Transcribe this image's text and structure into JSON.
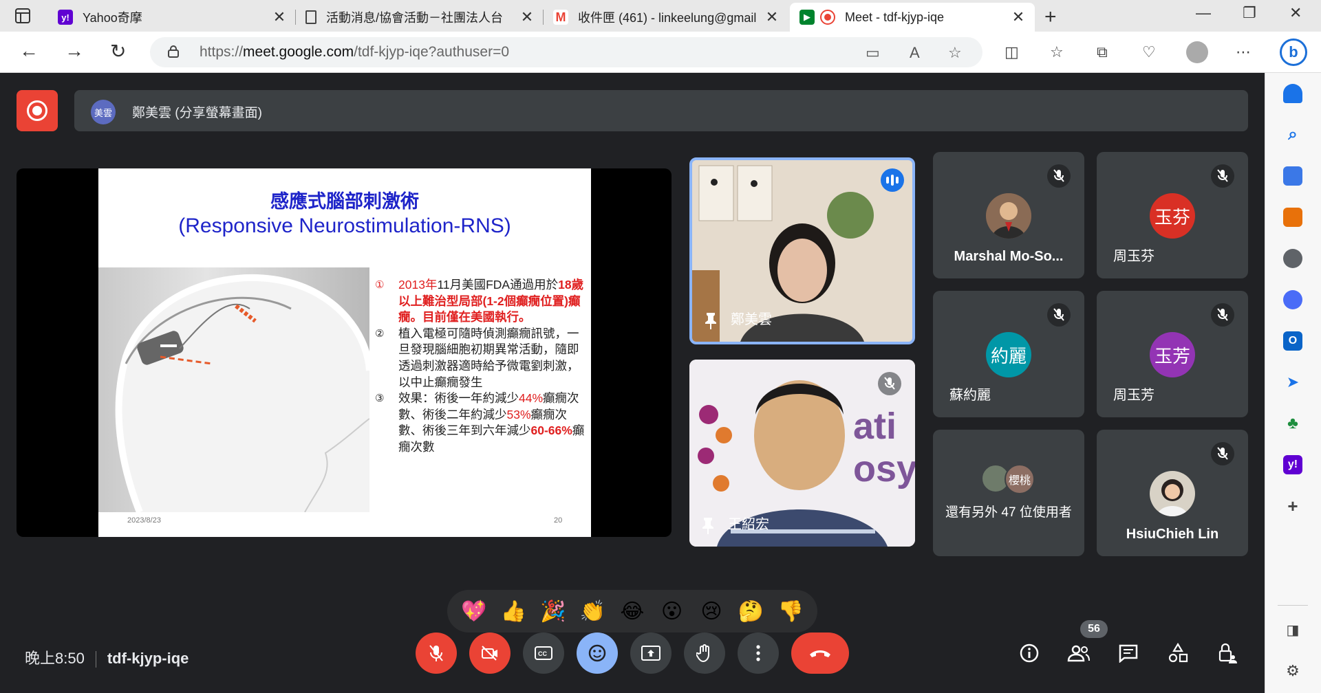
{
  "browser": {
    "tabs": [
      {
        "title": "Yahoo奇摩",
        "favicon": "yahoo-icon",
        "active": false
      },
      {
        "title": "活動消息/協會活動－社團法人台",
        "favicon": "document-icon",
        "active": false
      },
      {
        "title": "收件匣 (461) - linkeelung@gmail",
        "favicon": "gmail-icon",
        "active": false
      },
      {
        "title": "Meet - tdf-kjyp-iqe",
        "favicon": "meet-icon",
        "active": true
      }
    ],
    "url_prefix": "https://",
    "url_host": "meet.google.com",
    "url_path": "/tdf-kjyp-iqe?authuser=0",
    "new_tab_icon": "plus-icon"
  },
  "meet": {
    "presenter_initials": "美雲",
    "presenter_label": "鄭美雲 (分享螢幕畫面)",
    "slide": {
      "title_line1": "感應式腦部刺激術",
      "title_line2": "(Responsive Neurostimulation-RNS)",
      "item1_num": "①",
      "item1_a": "2013年",
      "item1_b": "11月美國FDA通過用於",
      "item1_c": "18歲以上難治型局部(1-2個癲癇位置)癲癇。目前僅在美國執行。",
      "item2_num": "②",
      "item2": "植入電極可隨時偵測癲癇訊號，一旦發現腦細胞初期異常活動，隨即透過刺激器適時給予微電劉刺激，以中止癲癇發生",
      "item3_num": "③",
      "item3_a": "效果：術後一年約減少",
      "item3_b": "44%",
      "item3_c": "癲癇次數、術後二年約減少",
      "item3_d": "53%",
      "item3_e": "癲癇次數、術後三年到六年減少",
      "item3_f": "60-66%",
      "item3_g": "癲癇次數",
      "date": "2023/8/23",
      "page": "20"
    },
    "tiles": {
      "speaker1": "鄭美雲",
      "speaker2": "王紹宏",
      "marshal": "Marshal Mo-So...",
      "yufen1_initials": "玉芬",
      "yufen1": "周玉芬",
      "yuehli_initials": "約麗",
      "yuehli": "蘇約麗",
      "yufang_initials": "玉芳",
      "yufang": "周玉芳",
      "others_chip": "櫻桃",
      "others": "還有另外 47 位使用者",
      "hsiuchieh": "HsiuChieh Lin",
      "bg_text_top": "ati",
      "bg_text_bottom": "osy"
    },
    "reactions": [
      "💖",
      "👍",
      "🎉",
      "👏",
      "😂",
      "😮",
      "😢",
      "🤔",
      "👎"
    ],
    "time": "晚上8:50",
    "meeting_code": "tdf-kjyp-iqe",
    "participants_count": "56",
    "colors": {
      "red": "#ea4335",
      "blue": "#8ab4f8",
      "bg": "#202124",
      "tile": "#3c4043"
    }
  }
}
